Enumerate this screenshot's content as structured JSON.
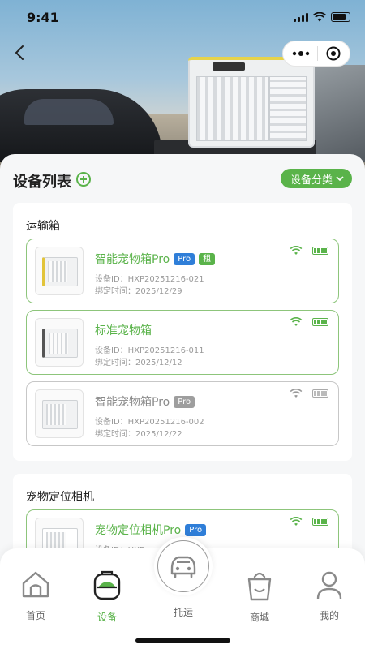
{
  "status": {
    "time": "9:41"
  },
  "header": {
    "title": "设备列表",
    "category_button": "设备分类"
  },
  "groups": [
    {
      "title": "运输箱",
      "devices": [
        {
          "name": "智能宠物箱Pro",
          "pro": "Pro",
          "rent": "租",
          "id": "设备ID：HXP20251216-021",
          "bind": "绑定时间：2025/12/29",
          "online": true
        },
        {
          "name": "标准宠物箱",
          "id": "设备ID：HXP20251216-011",
          "bind": "绑定时间：2025/12/12",
          "online": true
        },
        {
          "name": "智能宠物箱Pro",
          "pro": "Pro",
          "id": "设备ID：HXP20251216-002",
          "bind": "绑定时间：2025/12/22",
          "online": false
        }
      ]
    },
    {
      "title": "宠物定位相机",
      "devices": [
        {
          "name": "宠物定位相机Pro",
          "pro": "Pro",
          "id": "设备ID：HXP",
          "online": true
        }
      ]
    }
  ],
  "tabbar": {
    "home": "首页",
    "device": "设备",
    "transport": "托运",
    "mall": "商城",
    "mine": "我的",
    "active": "device"
  },
  "colors": {
    "accent": "#5ab34a",
    "pro_tag": "#2f7ed8"
  }
}
